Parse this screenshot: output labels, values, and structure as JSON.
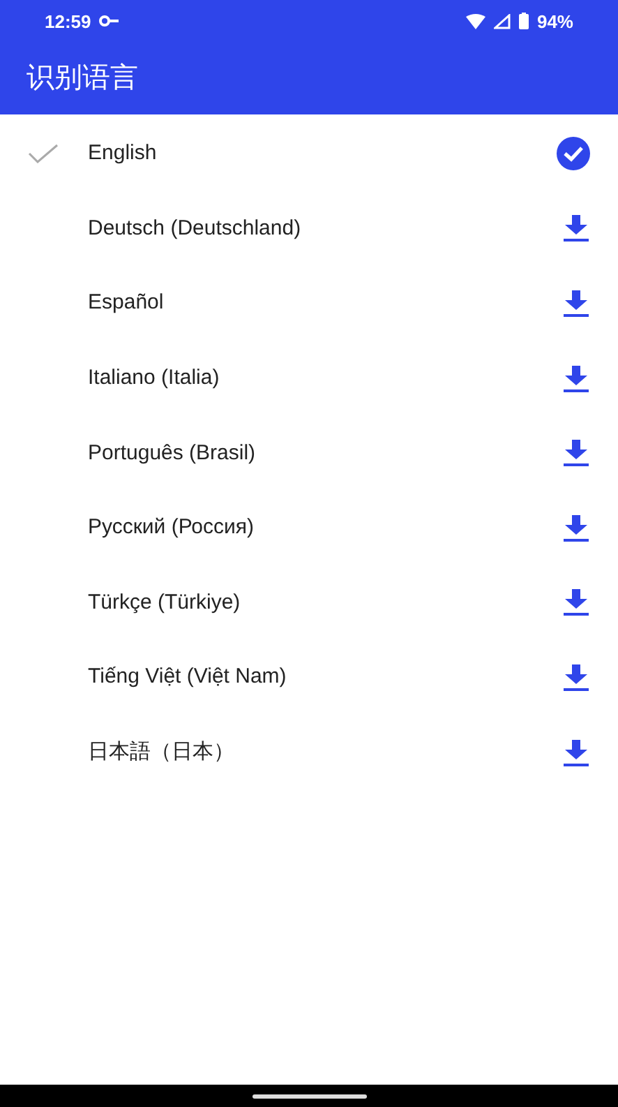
{
  "status_bar": {
    "time": "12:59",
    "battery": "94%"
  },
  "app_bar": {
    "title": "识别语言"
  },
  "languages": [
    {
      "name": "English",
      "selected": true,
      "downloaded": true
    },
    {
      "name": "Deutsch (Deutschland)",
      "selected": false,
      "downloaded": false
    },
    {
      "name": "Español",
      "selected": false,
      "downloaded": false
    },
    {
      "name": "Italiano (Italia)",
      "selected": false,
      "downloaded": false
    },
    {
      "name": "Português (Brasil)",
      "selected": false,
      "downloaded": false
    },
    {
      "name": "Русский (Россия)",
      "selected": false,
      "downloaded": false
    },
    {
      "name": "Türkçe (Türkiye)",
      "selected": false,
      "downloaded": false
    },
    {
      "name": "Tiếng Việt (Việt Nam)",
      "selected": false,
      "downloaded": false
    },
    {
      "name": "日本語（日本）",
      "selected": false,
      "downloaded": false
    }
  ]
}
